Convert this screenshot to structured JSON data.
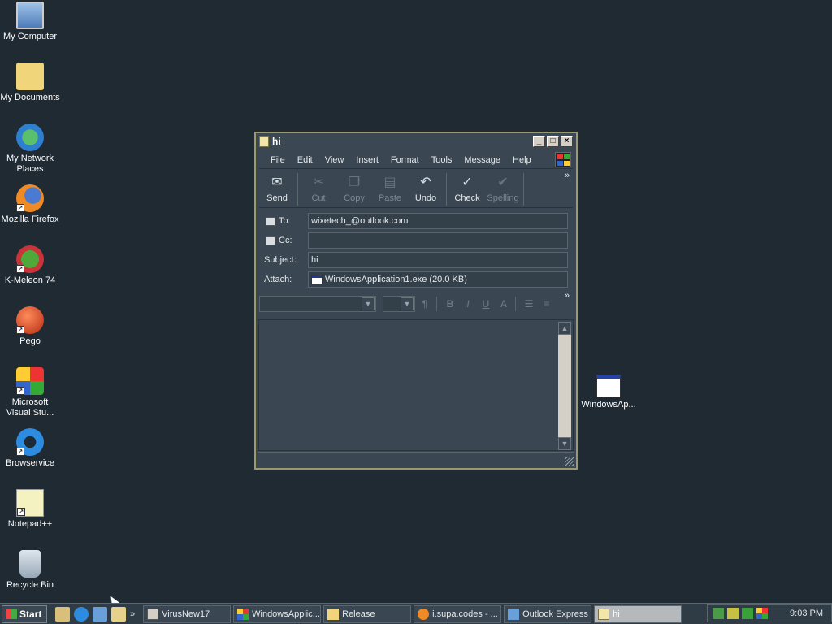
{
  "desktop": {
    "icons": [
      {
        "label": "My Computer",
        "icon": "computer-icon"
      },
      {
        "label": "My Documents",
        "icon": "folder-icon"
      },
      {
        "label": "My Network Places",
        "icon": "network-icon"
      },
      {
        "label": "Mozilla Firefox",
        "icon": "firefox-icon"
      },
      {
        "label": "K-Meleon 74",
        "icon": "kmeleon-icon"
      },
      {
        "label": "Pego",
        "icon": "pego-icon"
      },
      {
        "label": "Microsoft Visual Stu...",
        "icon": "visual-studio-icon"
      },
      {
        "label": "Browservice",
        "icon": "ie-icon"
      },
      {
        "label": "Notepad++",
        "icon": "notepad-icon"
      },
      {
        "label": "Recycle Bin",
        "icon": "recycle-bin-icon"
      }
    ],
    "right_icon": {
      "label": "WindowsAp...",
      "icon": "application-window-icon"
    }
  },
  "window": {
    "title": "hi",
    "menu": [
      "File",
      "Edit",
      "View",
      "Insert",
      "Format",
      "Tools",
      "Message",
      "Help"
    ],
    "toolbar": [
      {
        "label": "Send",
        "enabled": true
      },
      {
        "label": "Cut",
        "enabled": false
      },
      {
        "label": "Copy",
        "enabled": false
      },
      {
        "label": "Paste",
        "enabled": false
      },
      {
        "label": "Undo",
        "enabled": true
      },
      {
        "label": "Check",
        "enabled": true
      },
      {
        "label": "Spelling",
        "enabled": false
      }
    ],
    "fields": {
      "to_label": "To:",
      "to_value": "wixetech_@outlook.com",
      "cc_label": "Cc:",
      "cc_value": "",
      "subject_label": "Subject:",
      "subject_value": "hi",
      "attach_label": "Attach:",
      "attach_value": "WindowsApplication1.exe (20.0 KB)"
    },
    "format_buttons": [
      "B",
      "I",
      "U",
      "A"
    ]
  },
  "taskbar": {
    "start_label": "Start",
    "tasks": [
      {
        "label": "VirusNew17",
        "active": false
      },
      {
        "label": "WindowsApplic...",
        "active": false
      },
      {
        "label": "Release",
        "active": false
      },
      {
        "label": "i.supa.codes - ...",
        "active": false
      },
      {
        "label": "Outlook Express",
        "active": false
      },
      {
        "label": "hi",
        "active": true
      }
    ],
    "clock": "9:03 PM"
  },
  "colors": {
    "desktop_bg": "#1f2a33",
    "window_bg": "#3a4752",
    "window_border": "#9c9a6a"
  }
}
